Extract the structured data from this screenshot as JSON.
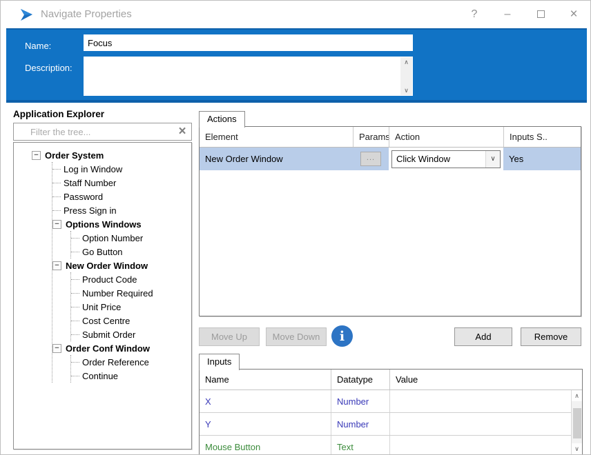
{
  "window": {
    "title": "Navigate Properties"
  },
  "icons": {
    "help": "?",
    "minimize": "–",
    "close": "×",
    "chevron_up": "∧",
    "chevron_down": "∨",
    "dropdown": "∨",
    "clear": "×",
    "collapse": "−",
    "ellipsis": "...",
    "info": "i"
  },
  "header": {
    "name_label": "Name:",
    "name_value": "Focus",
    "description_label": "Description:",
    "description_value": ""
  },
  "explorer": {
    "title": "Application Explorer",
    "filter_placeholder": "Filter the tree...",
    "tree": [
      {
        "label": "Order System"
      },
      {
        "label": "Log in Window"
      },
      {
        "label": "Staff Number"
      },
      {
        "label": "Password"
      },
      {
        "label": "Press Sign in"
      },
      {
        "label": "Options Windows"
      },
      {
        "label": "Option Number"
      },
      {
        "label": "Go Button"
      },
      {
        "label": "New Order Window"
      },
      {
        "label": "Product Code"
      },
      {
        "label": "Number Required"
      },
      {
        "label": "Unit Price"
      },
      {
        "label": "Cost Centre"
      },
      {
        "label": "Submit Order"
      },
      {
        "label": "Order Conf Window"
      },
      {
        "label": "Order Reference"
      },
      {
        "label": "Continue"
      }
    ]
  },
  "actions": {
    "tab_label": "Actions",
    "columns": [
      "Element",
      "Params",
      "Action",
      "Inputs S.."
    ],
    "row": {
      "element": "New Order Window",
      "action_value": "Click Window",
      "inputs_set": "Yes"
    },
    "move_up": "Move Up",
    "move_down": "Move Down",
    "add": "Add",
    "remove": "Remove"
  },
  "inputs": {
    "tab_label": "Inputs",
    "columns": [
      "Name",
      "Datatype",
      "Value"
    ],
    "rows": [
      {
        "name": "X",
        "datatype": "Number",
        "value": ""
      },
      {
        "name": "Y",
        "datatype": "Number",
        "value": ""
      },
      {
        "name": "Mouse Button",
        "datatype": "Text",
        "value": ""
      }
    ]
  },
  "colors": {
    "header_blue": "#1173c5",
    "header_blue_dark": "#0e60aa",
    "selection_blue": "#b9cde9",
    "link_navy": "#3a3ab8",
    "link_green": "#3c8c3c",
    "info_blue": "#2d74c4"
  }
}
